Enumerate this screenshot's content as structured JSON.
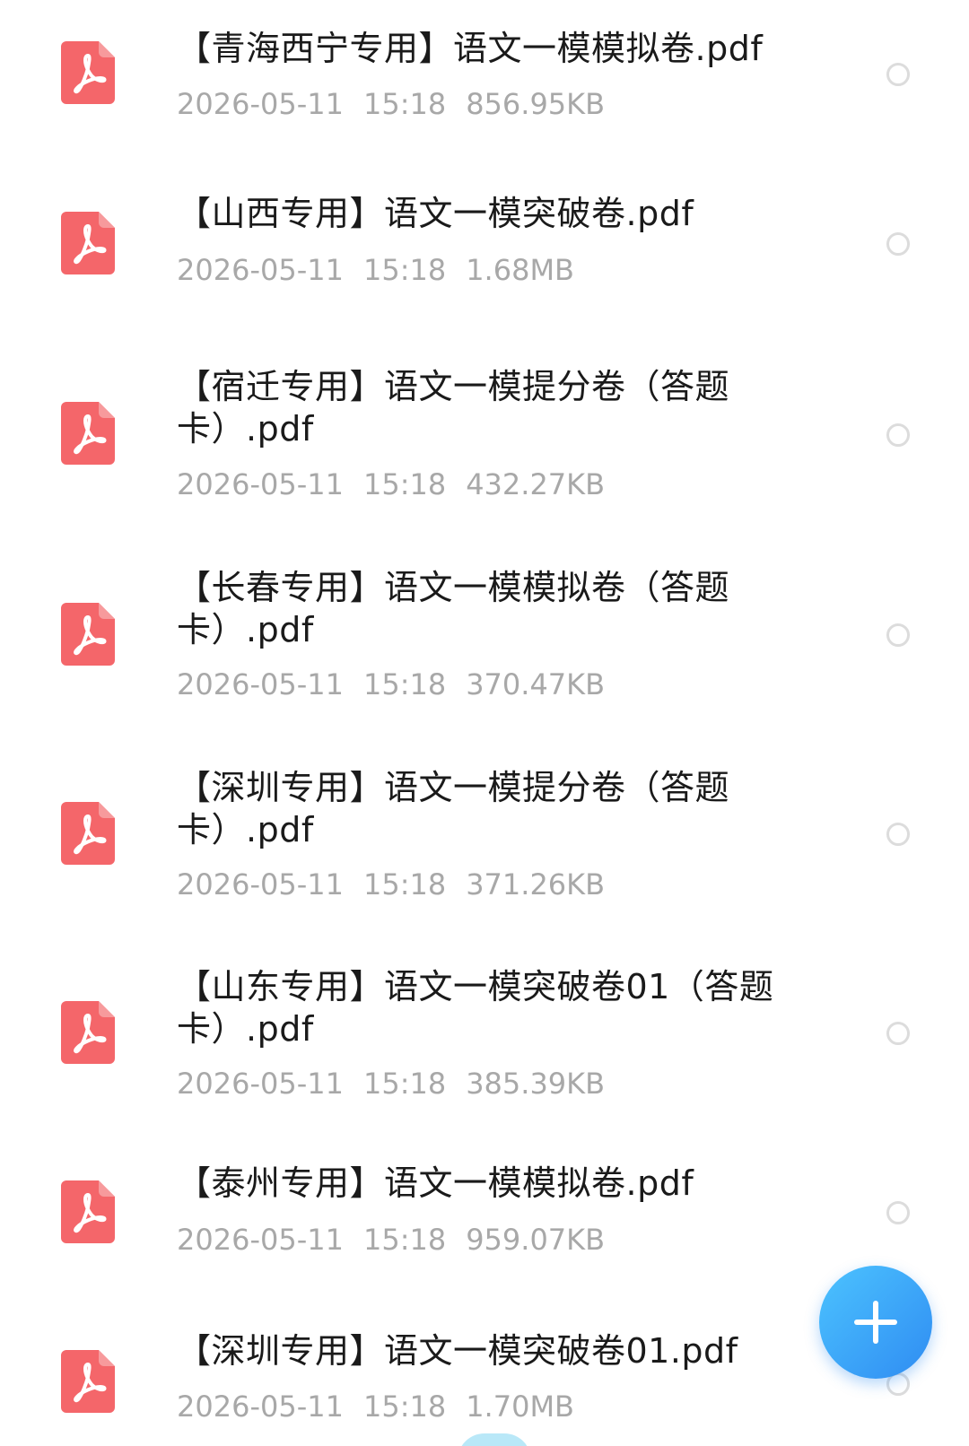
{
  "files": [
    {
      "name": "【青海西宁专用】语文一模模拟卷.pdf",
      "date": "2026-05-11",
      "time": "15:18",
      "size": "856.95KB"
    },
    {
      "name": "【山西专用】语文一模突破卷.pdf",
      "date": "2026-05-11",
      "time": "15:18",
      "size": "1.68MB"
    },
    {
      "name": "【宿迁专用】语文一模提分卷（答题卡）.pdf",
      "date": "2026-05-11",
      "time": "15:18",
      "size": "432.27KB"
    },
    {
      "name": "【长春专用】语文一模模拟卷（答题卡）.pdf",
      "date": "2026-05-11",
      "time": "15:18",
      "size": "370.47KB"
    },
    {
      "name": "【深圳专用】语文一模提分卷（答题卡）.pdf",
      "date": "2026-05-11",
      "time": "15:18",
      "size": "371.26KB"
    },
    {
      "name": "【山东专用】语文一模突破卷01（答题卡）.pdf",
      "date": "2026-05-11",
      "time": "15:18",
      "size": "385.39KB"
    },
    {
      "name": "【泰州专用】语文一模模拟卷.pdf",
      "date": "2026-05-11",
      "time": "15:18",
      "size": "959.07KB"
    },
    {
      "name": "【深圳专用】语文一模突破卷01.pdf",
      "date": "2026-05-11",
      "time": "15:18",
      "size": "1.70MB"
    }
  ],
  "icons": {
    "file_type": "pdf-file-icon",
    "fab": "plus-icon",
    "select": "radio-circle-icon"
  },
  "colors": {
    "pdf_icon": "#f4666a",
    "fab": "#2f8cf2",
    "meta_text": "#a8a8a8",
    "name_text": "#1a1a1a"
  }
}
